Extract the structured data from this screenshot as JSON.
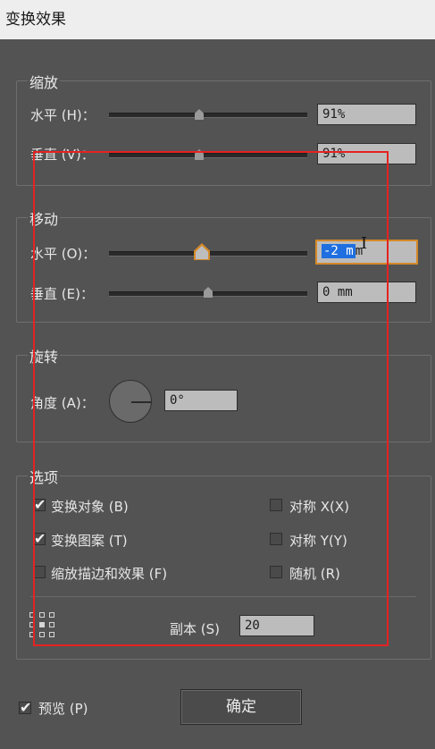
{
  "window": {
    "title": "变换效果"
  },
  "scale": {
    "legend": "缩放",
    "horizontal": {
      "label": "水平 (H)：",
      "value": "91%",
      "slider_fraction": 0.5
    },
    "vertical": {
      "label": "垂直 (V)：",
      "value": "91%",
      "slider_fraction": 0.5
    }
  },
  "move": {
    "legend": "移动",
    "horizontal": {
      "label": "水平 (O)：",
      "value": "-2 mm",
      "value_selected": "-2 m",
      "value_rest": "m",
      "slider_fraction": 0.47
    },
    "vertical": {
      "label": "垂直 (E)：",
      "value": "0 mm",
      "slider_fraction": 0.5
    }
  },
  "rotate": {
    "legend": "旋转",
    "angle": {
      "label": "角度 (A)：",
      "value": "0°"
    }
  },
  "options": {
    "legend": "选项",
    "transform_objects": {
      "label": "变换对象 (B)",
      "checked": true
    },
    "transform_patterns": {
      "label": "变换图案 (T)",
      "checked": true
    },
    "scale_strokes": {
      "label": "缩放描边和效果 (F)",
      "checked": false
    },
    "reflect_x": {
      "label": "对称 X(X)",
      "checked": false
    },
    "reflect_y": {
      "label": "对称 Y(Y)",
      "checked": false
    },
    "random": {
      "label": "随机 (R)",
      "checked": false
    },
    "copies": {
      "label": "副本 (S)",
      "value": "20"
    }
  },
  "footer": {
    "preview": {
      "label": "预览 (P)",
      "checked": true
    },
    "ok_label": "确定"
  },
  "colors": {
    "highlight": "#e52222",
    "focus": "#d5892a",
    "selection": "#1f6fe0"
  }
}
